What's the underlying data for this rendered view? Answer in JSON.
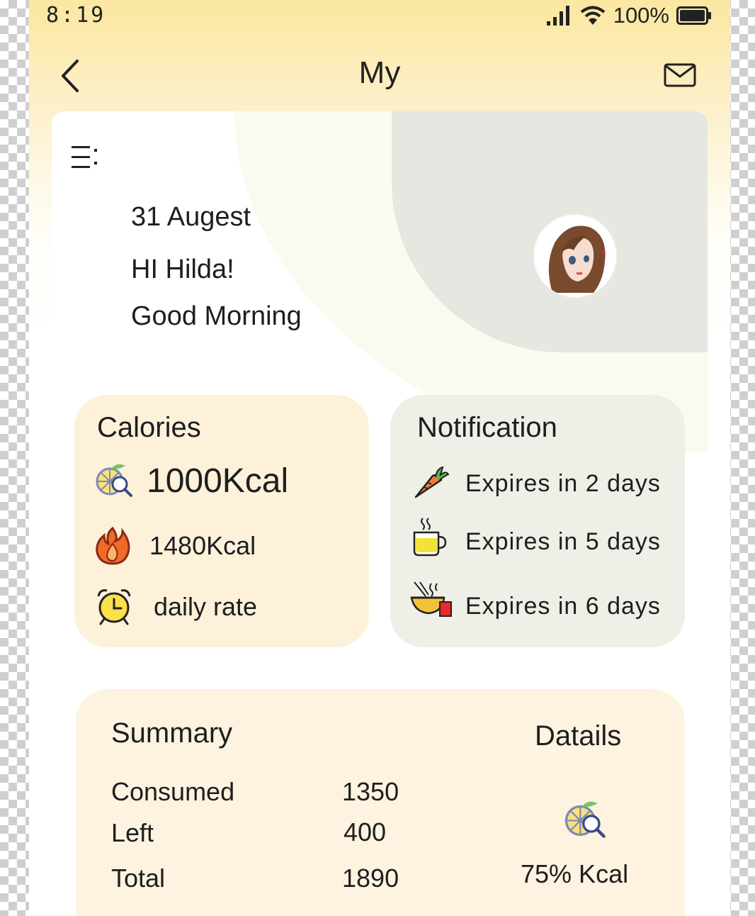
{
  "status_bar": {
    "time": "8:19",
    "battery_text": "100%"
  },
  "nav": {
    "title": "My"
  },
  "hero": {
    "date": "31 Augest",
    "greeting": "HI Hilda!",
    "salutation": "Good Morning"
  },
  "calories": {
    "title": "Calories",
    "goal": "1000Kcal",
    "burned": "1480Kcal",
    "rate_label": "daily rate"
  },
  "notification": {
    "title": "Notification",
    "items": [
      {
        "icon": "carrot-icon",
        "text": "Expires in 2 days"
      },
      {
        "icon": "tea-cup-icon",
        "text": "Expires in 5 days"
      },
      {
        "icon": "noodle-bowl-icon",
        "text": "Expires in 6 days"
      }
    ]
  },
  "summary": {
    "title": "Summary",
    "details_label": "Datails",
    "rows": [
      {
        "label": "Consumed",
        "value": "1350"
      },
      {
        "label": "Left",
        "value": "400"
      },
      {
        "label": "Total",
        "value": "1890"
      }
    ],
    "percent": "75% Kcal"
  },
  "colors": {
    "header_yellow": "#fbe7a0",
    "calories_card": "#fdf1da",
    "notification_card": "#eeefe7",
    "summary_card": "#fdf3e0"
  }
}
